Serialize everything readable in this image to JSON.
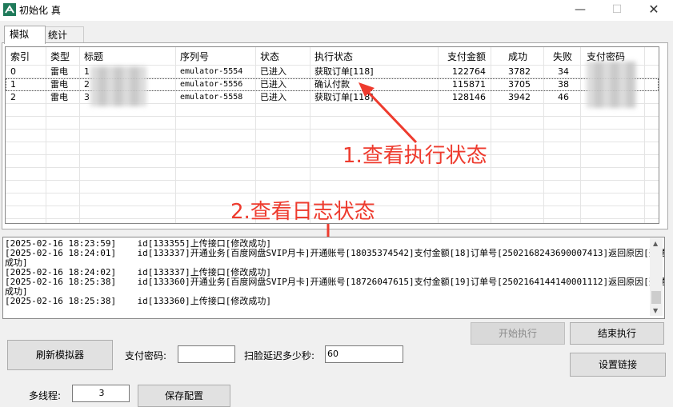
{
  "window": {
    "title": "初始化 真",
    "minimize": "—",
    "maximize": "☐",
    "close": "✕"
  },
  "tabs": [
    {
      "label": "模拟"
    },
    {
      "label": "统计"
    }
  ],
  "table": {
    "columns": [
      "索引",
      "类型",
      "标题",
      "序列号",
      "状态",
      "执行状态",
      "支付金额",
      "成功",
      "失败",
      "支付密码"
    ],
    "rows": [
      {
        "index": "0",
        "type": "雷电",
        "title": "1",
        "serial": "emulator-5554",
        "status": "已进入",
        "exec": "获取订单[118]",
        "amount": "122764",
        "success": "3782",
        "fail": "34"
      },
      {
        "index": "1",
        "type": "雷电",
        "title": "2",
        "serial": "emulator-5556",
        "status": "已进入",
        "exec": "确认付款",
        "amount": "115871",
        "success": "3705",
        "fail": "38"
      },
      {
        "index": "2",
        "type": "雷电",
        "title": "3",
        "serial": "emulator-5558",
        "status": "已进入",
        "exec": "获取订单[118]",
        "amount": "128146",
        "success": "3942",
        "fail": "46"
      }
    ]
  },
  "annotations": {
    "a1": "1.查看执行状态",
    "a2": "2.查看日志状态"
  },
  "log": [
    "[2025-02-16 18:23:59]    id[133355]上传接口[修改成功]",
    "[2025-02-16 18:24:01]    id[133337]开通业务[百度网盘SVIP月卡]开通账号[18035374542]支付金额[18]订单号[2502168243690007413]返回原因[开通",
    "成功]",
    "[2025-02-16 18:24:02]    id[133337]上传接口[修改成功]",
    "[2025-02-16 18:25:38]    id[133360]开通业务[百度网盘SVIP月卡]开通账号[18726047615]支付金额[19]订单号[2502164144140001112]返回原因[开通",
    "成功]",
    "[2025-02-16 18:25:38]    id[133360]上传接口[修改成功]"
  ],
  "controls": {
    "start": "开始执行",
    "stop": "结束执行",
    "refresh": "刷新模拟器",
    "pay_pw_label": "支付密码:",
    "pay_pw_value": "",
    "scan_delay_label": "扫脸延迟多少秒:",
    "scan_delay_value": "60",
    "set_link": "设置链接",
    "threads_label": "多线程:",
    "threads_value": "3",
    "save": "保存配置"
  },
  "colors": {
    "annotation": "#ee3b2e"
  }
}
